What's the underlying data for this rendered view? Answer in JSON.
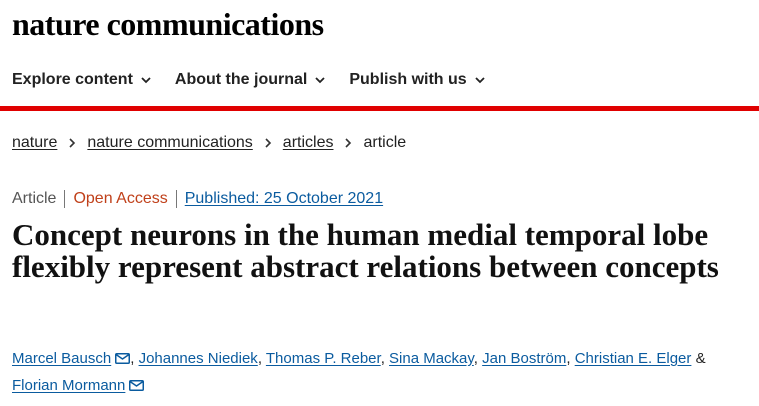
{
  "site": {
    "name": "nature communications"
  },
  "nav": [
    {
      "label": "Explore content"
    },
    {
      "label": "About the journal"
    },
    {
      "label": "Publish with us"
    }
  ],
  "breadcrumb": [
    "nature",
    "nature communications",
    "articles",
    "article"
  ],
  "article": {
    "type": "Article",
    "access": "Open Access",
    "published": "Published: 25 October 2021",
    "title": "Concept neurons in the human medial temporal lobe flexibly represent abstract relations between concepts",
    "authors": [
      "Marcel Bausch",
      "Johannes Niediek",
      "Thomas P. Reber",
      "Sina Mackay",
      "Jan Boström",
      "Christian E. Elger",
      "Florian Mormann"
    ],
    "conj": "&"
  },
  "colors": {
    "accent_bar": "#e00000",
    "link": "#0a5b9f",
    "open_access": "#c0401a"
  },
  "icons": {
    "nav_chevron": "chevron-down-icon",
    "breadcrumb_sep": "chevron-right-icon",
    "author_mail": "mail-icon"
  }
}
